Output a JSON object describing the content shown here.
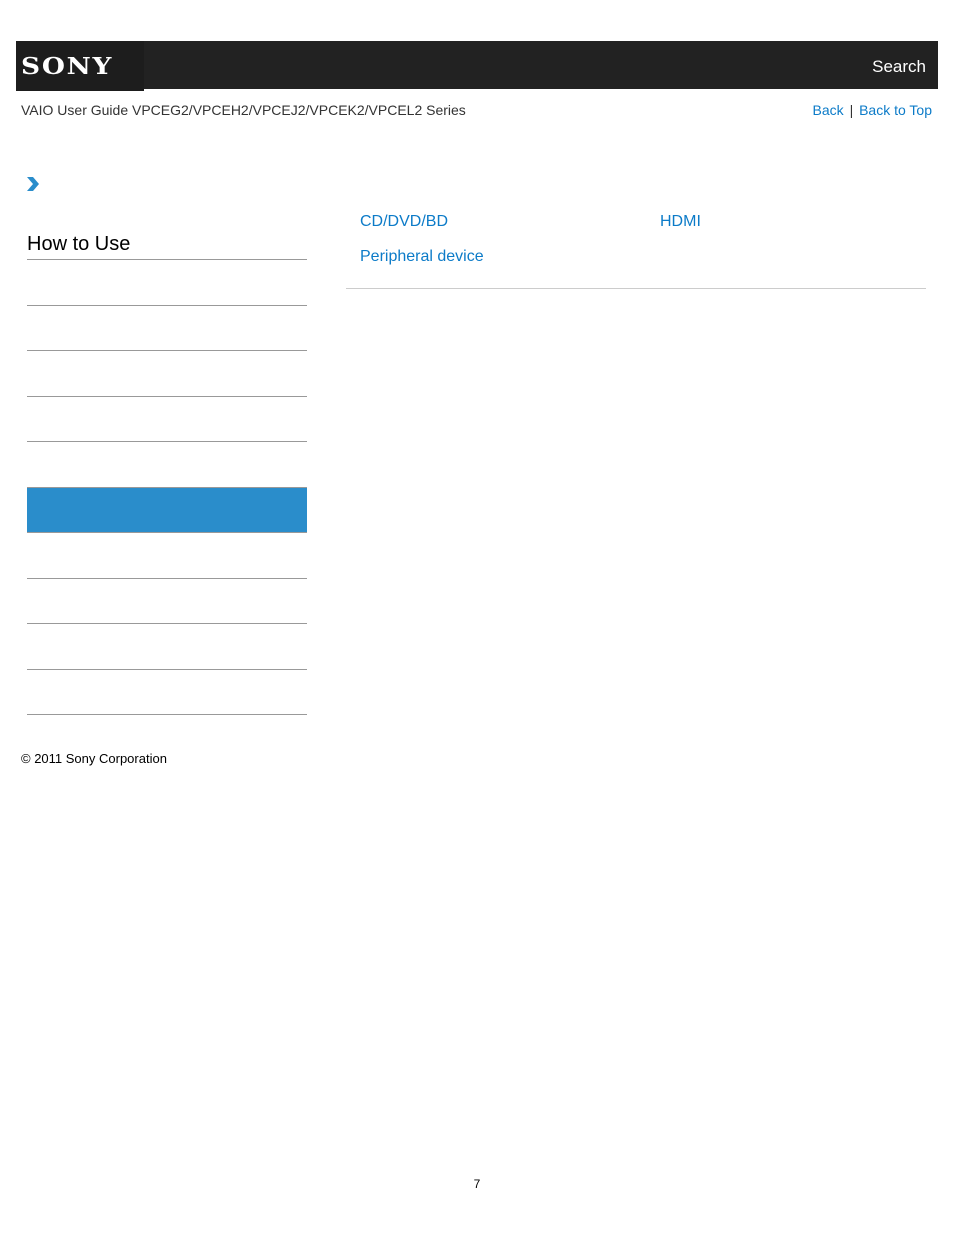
{
  "header": {
    "logo_text": "SONY",
    "search_label": "Search"
  },
  "subheader": {
    "guide_title": "VAIO User Guide VPCEG2/VPCEH2/VPCEJ2/VPCEK2/VPCEL2 Series",
    "back_label": "Back",
    "separator": "|",
    "back_to_top_label": "Back to Top"
  },
  "breadcrumb": {
    "icon": "chevron-right-icon"
  },
  "sidebar": {
    "heading": "How to Use",
    "items": [
      {
        "label": "",
        "selected": false
      },
      {
        "label": "",
        "selected": false
      },
      {
        "label": "",
        "selected": false
      },
      {
        "label": "",
        "selected": false
      },
      {
        "label": "",
        "selected": false
      },
      {
        "label": "",
        "selected": true
      },
      {
        "label": "",
        "selected": false
      },
      {
        "label": "",
        "selected": false
      },
      {
        "label": "",
        "selected": false
      },
      {
        "label": "",
        "selected": false
      }
    ],
    "selected_color": "#2a8dcb"
  },
  "content": {
    "links": [
      {
        "label": "CD/DVD/BD"
      },
      {
        "label": "HDMI"
      },
      {
        "label": "Peripheral device"
      }
    ],
    "link_color": "#0c7bc8"
  },
  "footer": {
    "copyright": "© 2011 Sony Corporation",
    "page_number": "7"
  }
}
